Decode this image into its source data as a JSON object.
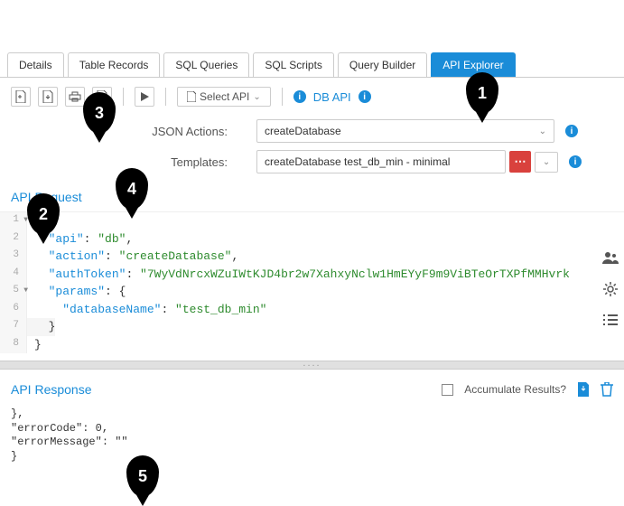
{
  "callouts": {
    "c1": "1",
    "c2": "2",
    "c3": "3",
    "c4": "4",
    "c5": "5"
  },
  "tabs": {
    "details": "Details",
    "records": "Table Records",
    "queries": "SQL Queries",
    "scripts": "SQL Scripts",
    "builder": "Query Builder",
    "explorer": "API Explorer"
  },
  "toolbar": {
    "select_api": "Select API",
    "db_api": "DB API"
  },
  "form": {
    "json_actions_label": "JSON Actions:",
    "json_actions_value": "createDatabase",
    "templates_label": "Templates:",
    "templates_value": "createDatabase test_db_min - minimal"
  },
  "request": {
    "title": "API Request",
    "lines": {
      "l1": "{",
      "l2_k": "\"api\"",
      "l2_v": "\"db\"",
      "l3_k": "\"action\"",
      "l3_v": "\"createDatabase\"",
      "l4_k": "\"authToken\"",
      "l4_v": "\"7WyVdNrcxWZuIWtKJD4br2w7XahxyNclw1HmEYyF9m9ViBTeOrTXPfMMHvrk",
      "l5_k": "\"params\"",
      "l6_k": "\"databaseName\"",
      "l6_v": "\"test_db_min\"",
      "l7": "}",
      "l8": "}"
    },
    "nums": {
      "n1": "1",
      "n2": "2",
      "n3": "3",
      "n4": "4",
      "n5": "5",
      "n6": "6",
      "n7": "7",
      "n8": "8"
    }
  },
  "response": {
    "title": "API Response",
    "accumulate": "Accumulate Results?",
    "body_l1": "},",
    "body_l2_k": "\"errorCode\"",
    "body_l2_v": "0",
    "body_l3_k": "\"errorMessage\"",
    "body_l3_v": "\"\"",
    "body_l4": "}"
  }
}
